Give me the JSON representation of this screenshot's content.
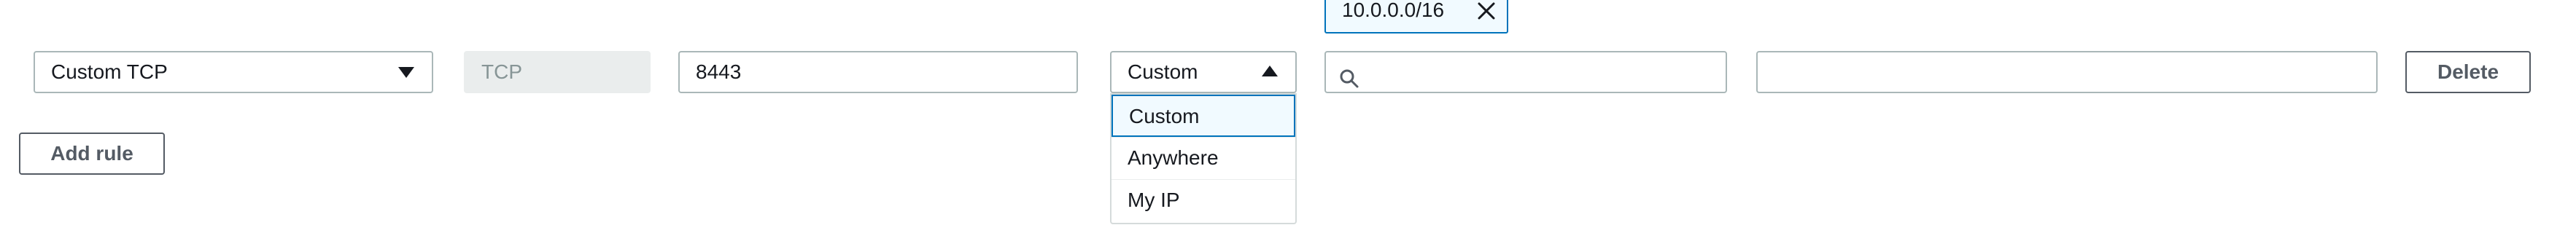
{
  "rule": {
    "type_value": "Custom TCP",
    "protocol_value": "TCP",
    "port_value": "8443",
    "source_type_value": "Custom",
    "source_search_value": "",
    "description_value": "",
    "delete_label": "Delete"
  },
  "source_token": {
    "label": "10.0.0.0/16"
  },
  "source_dropdown": {
    "options": [
      "Custom",
      "Anywhere",
      "My IP"
    ],
    "selected": "Custom"
  },
  "add_rule_label": "Add rule",
  "colors": {
    "accent": "#0073bb",
    "selected_bg": "#f1faff",
    "border": "#aab7b8",
    "disabled_bg": "#eaeded"
  },
  "icons": {
    "type_caret": "caret-down-icon",
    "source_caret": "caret-up-icon",
    "search": "search-icon",
    "remove": "close-icon"
  }
}
